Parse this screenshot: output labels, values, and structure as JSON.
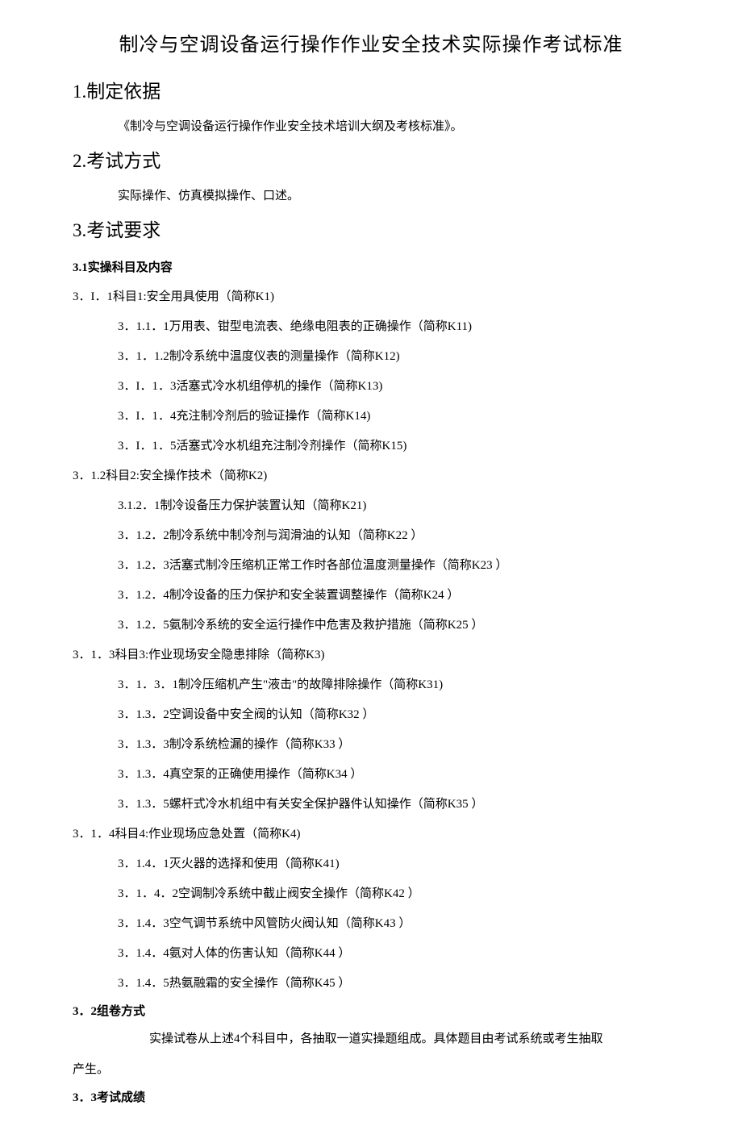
{
  "title": "制冷与空调设备运行操作作业安全技术实际操作考试标准",
  "sections": {
    "s1": {
      "heading": "1.制定依据",
      "body": "《制冷与空调设备运行操作作业安全技术培训大纲及考核标准》。"
    },
    "s2": {
      "heading": "2.考试方式",
      "body": "实际操作、仿真模拟操作、口述。"
    },
    "s3": {
      "heading": "3.考试要求"
    }
  },
  "s31_heading": "3.1实操科目及内容",
  "k1": {
    "title": "3．I．1科目1:安全用具使用（简称K1)",
    "items": [
      "3．1.1．1万用表、钳型电流表、绝缘电阻表的正确操作（简称K11)",
      "3．1．1.2制冷系统中温度仪表的测量操作（简称K12)",
      "3．I．1．3活塞式冷水机组停机的操作（简称K13)",
      "3．I．1．4充注制冷剂后的验证操作（简称K14)",
      "3．I．1．5活塞式冷水机组充注制冷剂操作（简称K15)"
    ]
  },
  "k2": {
    "title": "3．1.2科目2:安全操作技术（简称K2)",
    "items": [
      "3.1.2．1制冷设备压力保护装置认知（简称K21)",
      "3．1.2．2制冷系统中制冷剂与润滑油的认知（简称K22 ）",
      "3．1.2．3活塞式制冷压缩机正常工作时各部位温度测量操作（简称K23 ）",
      "3．1.2．4制冷设备的压力保护和安全装置调整操作（简称K24 ）",
      "3．1.2．5氨制冷系统的安全运行操作中危害及救护措施（简称K25 ）"
    ]
  },
  "k3": {
    "title": "3．1．3科目3:作业现场安全隐患排除（简称K3)",
    "items": [
      "3．1．3．1制冷压缩机产生\"液击\"的故障排除操作（简称K31)",
      "3．1.3．2空调设备中安全阀的认知（简称K32 ）",
      "3．1.3．3制冷系统检漏的操作（简称K33 ）",
      "3．1.3．4真空泵的正确使用操作（简称K34 ）",
      "3．1.3．5螺杆式冷水机组中有关安全保护器件认知操作（简称K35 ）"
    ]
  },
  "k4": {
    "title": "3．1．4科目4:作业现场应急处置（简称K4)",
    "items": [
      "3．1.4．1灭火器的选择和使用（简称K41)",
      "3．1．4．2空调制冷系统中截止阀安全操作（简称K42 ）",
      "3．1.4．3空气调节系统中风管防火阀认知（简称K43 ）",
      "3．1.4．4氨对人体的伤害认知（简称K44 ）",
      "3．1.4．5热氨融霜的安全操作（简称K45 ）"
    ]
  },
  "s32": {
    "heading": "3．2组卷方式",
    "body_lead": "实操试卷从上述4个科目中，各抽取一道实操题组成。具体题目由考试系统或考生抽取",
    "body_cont": "产生。"
  },
  "s33_heading": "3．3考试成绩"
}
